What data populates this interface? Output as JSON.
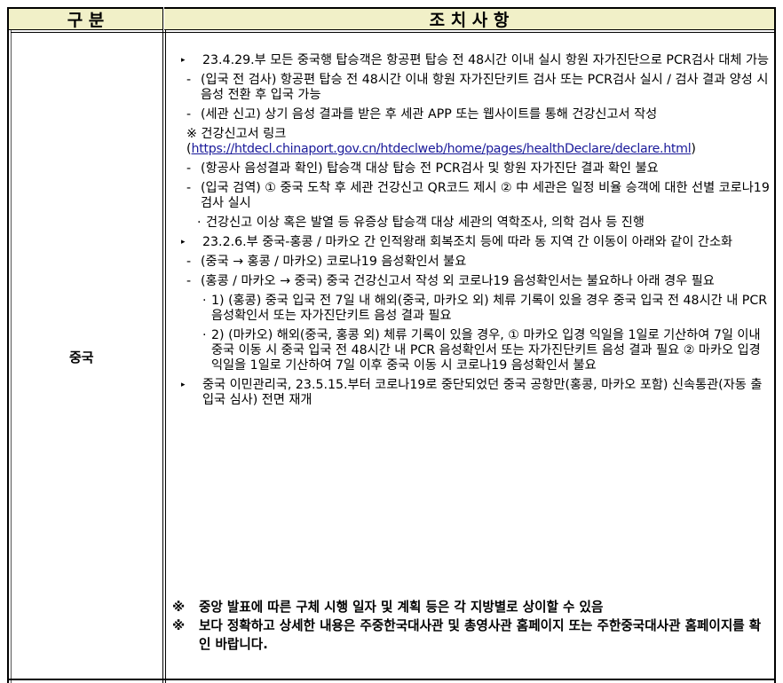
{
  "header": {
    "col1": "구  분",
    "col2": "조  치  사  항"
  },
  "country": "중국",
  "items": [
    {
      "level": 0,
      "marker": "▸",
      "text": "23.4.29.부 모든 중국행 탑승객은 항공편 탑승 전 48시간 이내 실시 항원 자가진단으로 PCR검사 대체 가능"
    },
    {
      "level": 1,
      "marker": "-",
      "text": "(입국 전 검사) 항공편 탑승 전 48시간 이내 항원 자가진단키트 검사 또는 PCR검사 실시 / 검사 결과 양성 시 음성 전환 후 입국 가능"
    },
    {
      "level": 1,
      "marker": "-",
      "text": "(세관 신고) 상기 음성 결과를 받은 후 세관 APP 또는 웹사이트를 통해 건강신고서 작성"
    },
    {
      "level": "link",
      "marker": "※",
      "text": "건강신고서 링크(",
      "link": "https://htdecl.chinaport.gov.cn/htdeclweb/home/pages/healthDeclare/declare.html",
      "tail": ")"
    },
    {
      "level": 1,
      "marker": "-",
      "text": "(항공사 음성결과 확인) 탑승객 대상 탑승 전 PCR검사 및 항원 자가진단 결과 확인 불요"
    },
    {
      "level": 1,
      "marker": "-",
      "text": "(입국 검역) ① 중국 도착 후 세관 건강신고 QR코드 제시 ② 中 세관은 일정 비율 승객에 대한 선별 코로나19 검사 실시"
    },
    {
      "level": 2,
      "marker": "·",
      "text": "건강신고 이상 혹은 발열 등 유증상 탑승객 대상 세관의 역학조사, 의학 검사 등 진행"
    },
    {
      "level": 0,
      "marker": "▸",
      "text": "23.2.6.부 중국-홍콩 / 마카오 간 인적왕래 회복조치 등에 따라 동 지역 간 이동이 아래와 같이 간소화"
    },
    {
      "level": 1,
      "marker": "-",
      "text": "(중국 → 홍콩 / 마카오) 코로나19 음성확인서 불요"
    },
    {
      "level": 1,
      "marker": "-",
      "text": "(홍콩 / 마카오 → 중국) 중국 건강신고서 작성 외 코로나19 음성확인서는 불요하나 아래 경우 필요"
    },
    {
      "level": 3,
      "marker": "·",
      "text": "1) (홍콩) 중국 입국 전 7일 내 해외(중국, 마카오 외) 체류 기록이 있을 경우 중국 입국 전 48시간 내 PCR 음성확인서 또는 자가진단키트 음성 결과 필요"
    },
    {
      "level": 3,
      "marker": "·",
      "text": "2) (마카오) 해외(중국, 홍콩 외) 체류 기록이 있을 경우, ① 마카오 입경 익일을 1일로 기산하여 7일 이내 중국 이동 시 중국 입국 전 48시간 내 PCR 음성확인서 또는 자가진단키트 음성 결과 필요 ② 마카오 입경 익일을 1일로 기산하여 7일 이후 중국 이동 시 코로나19 음성확인서 불요"
    },
    {
      "level": 0,
      "marker": "▸",
      "text": "중국 이민관리국, 23.5.15.부터 코로나19로 중단되었던 중국 공항만(홍콩, 마카오 포함) 신속통관(자동 출입국 심사) 전면 재개"
    }
  ],
  "notes": [
    {
      "marker": "※",
      "text": "중앙 발표에 따른 구체 시행 일자 및 계획 등은 각 지방별로 상이할 수 있음"
    },
    {
      "marker": "※",
      "text": "보다 정확하고 상세한 내용은 주중한국대사관 및 총영사관 홈페이지 또는 주한중국대사관 홈페이지를 확인 바랍니다."
    }
  ]
}
